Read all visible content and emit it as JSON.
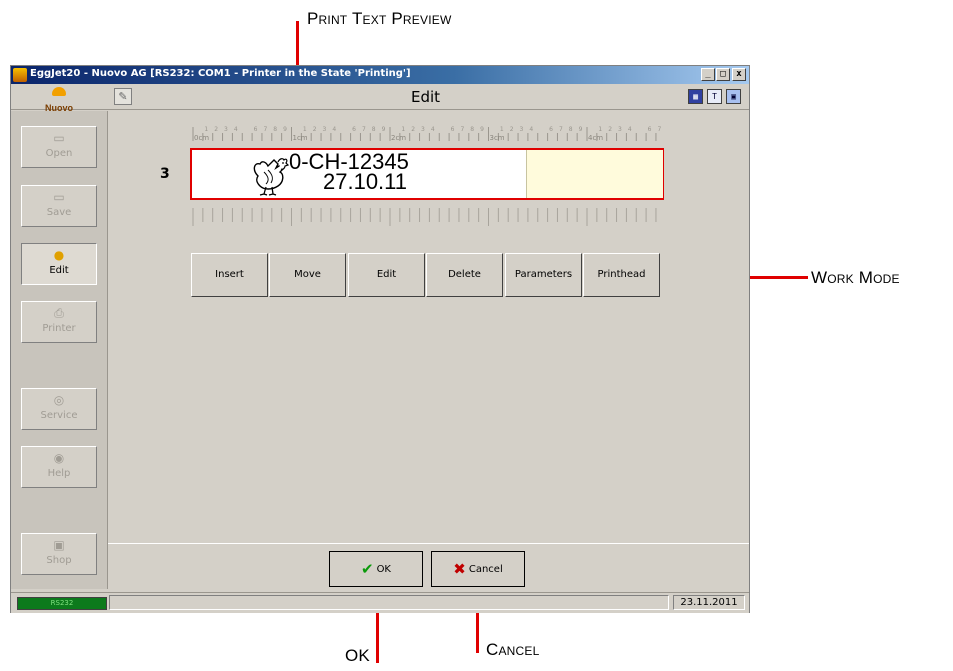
{
  "annotations": {
    "print_text_preview": "Print Text Preview",
    "work_mode": "Work Mode",
    "ok": "OK",
    "cancel": "Cancel"
  },
  "window": {
    "title": "EggJet20 - Nuovo AG   [RS232: COM1 - Printer in the State 'Printing']",
    "controls": {
      "minimize": "_",
      "maximize": "□",
      "close": "x"
    }
  },
  "header": {
    "logo": "Nuovo",
    "page_title": "Edit",
    "icons": [
      "grid-icon",
      "text-icon",
      "image-icon"
    ]
  },
  "sidebar": {
    "items": [
      {
        "label": "Open",
        "icon": "folder-open-icon",
        "enabled": false
      },
      {
        "label": "Save",
        "icon": "folder-icon",
        "enabled": false
      },
      {
        "label": "Edit",
        "icon": "egg-icon",
        "enabled": true,
        "active": true
      },
      {
        "label": "Printer",
        "icon": "printer-icon",
        "enabled": false
      },
      {
        "label": "Service",
        "icon": "service-icon",
        "enabled": false
      },
      {
        "label": "Help",
        "icon": "help-icon",
        "enabled": false
      },
      {
        "label": "Shop",
        "icon": "shop-icon",
        "enabled": false
      }
    ]
  },
  "editor": {
    "line_number": "3",
    "ruler_labels": [
      "0cm",
      "1cm",
      "2cm",
      "3cm",
      "4cm"
    ],
    "preview_line1": "0-CH-12345",
    "preview_line2": "27.10.11",
    "preview_icon": "hen-icon"
  },
  "modes": [
    "Insert",
    "Move",
    "Edit",
    "Delete",
    "Parameters",
    "Printhead"
  ],
  "dialog": {
    "ok": "OK",
    "cancel": "Cancel"
  },
  "status": {
    "connection": "RS232",
    "date": "23.11.2011"
  },
  "colors": {
    "annotation": "#e00000",
    "titlebar": "#0a246a",
    "connection": "#0c7a1c",
    "preview_highlight": "#fffbdc"
  }
}
